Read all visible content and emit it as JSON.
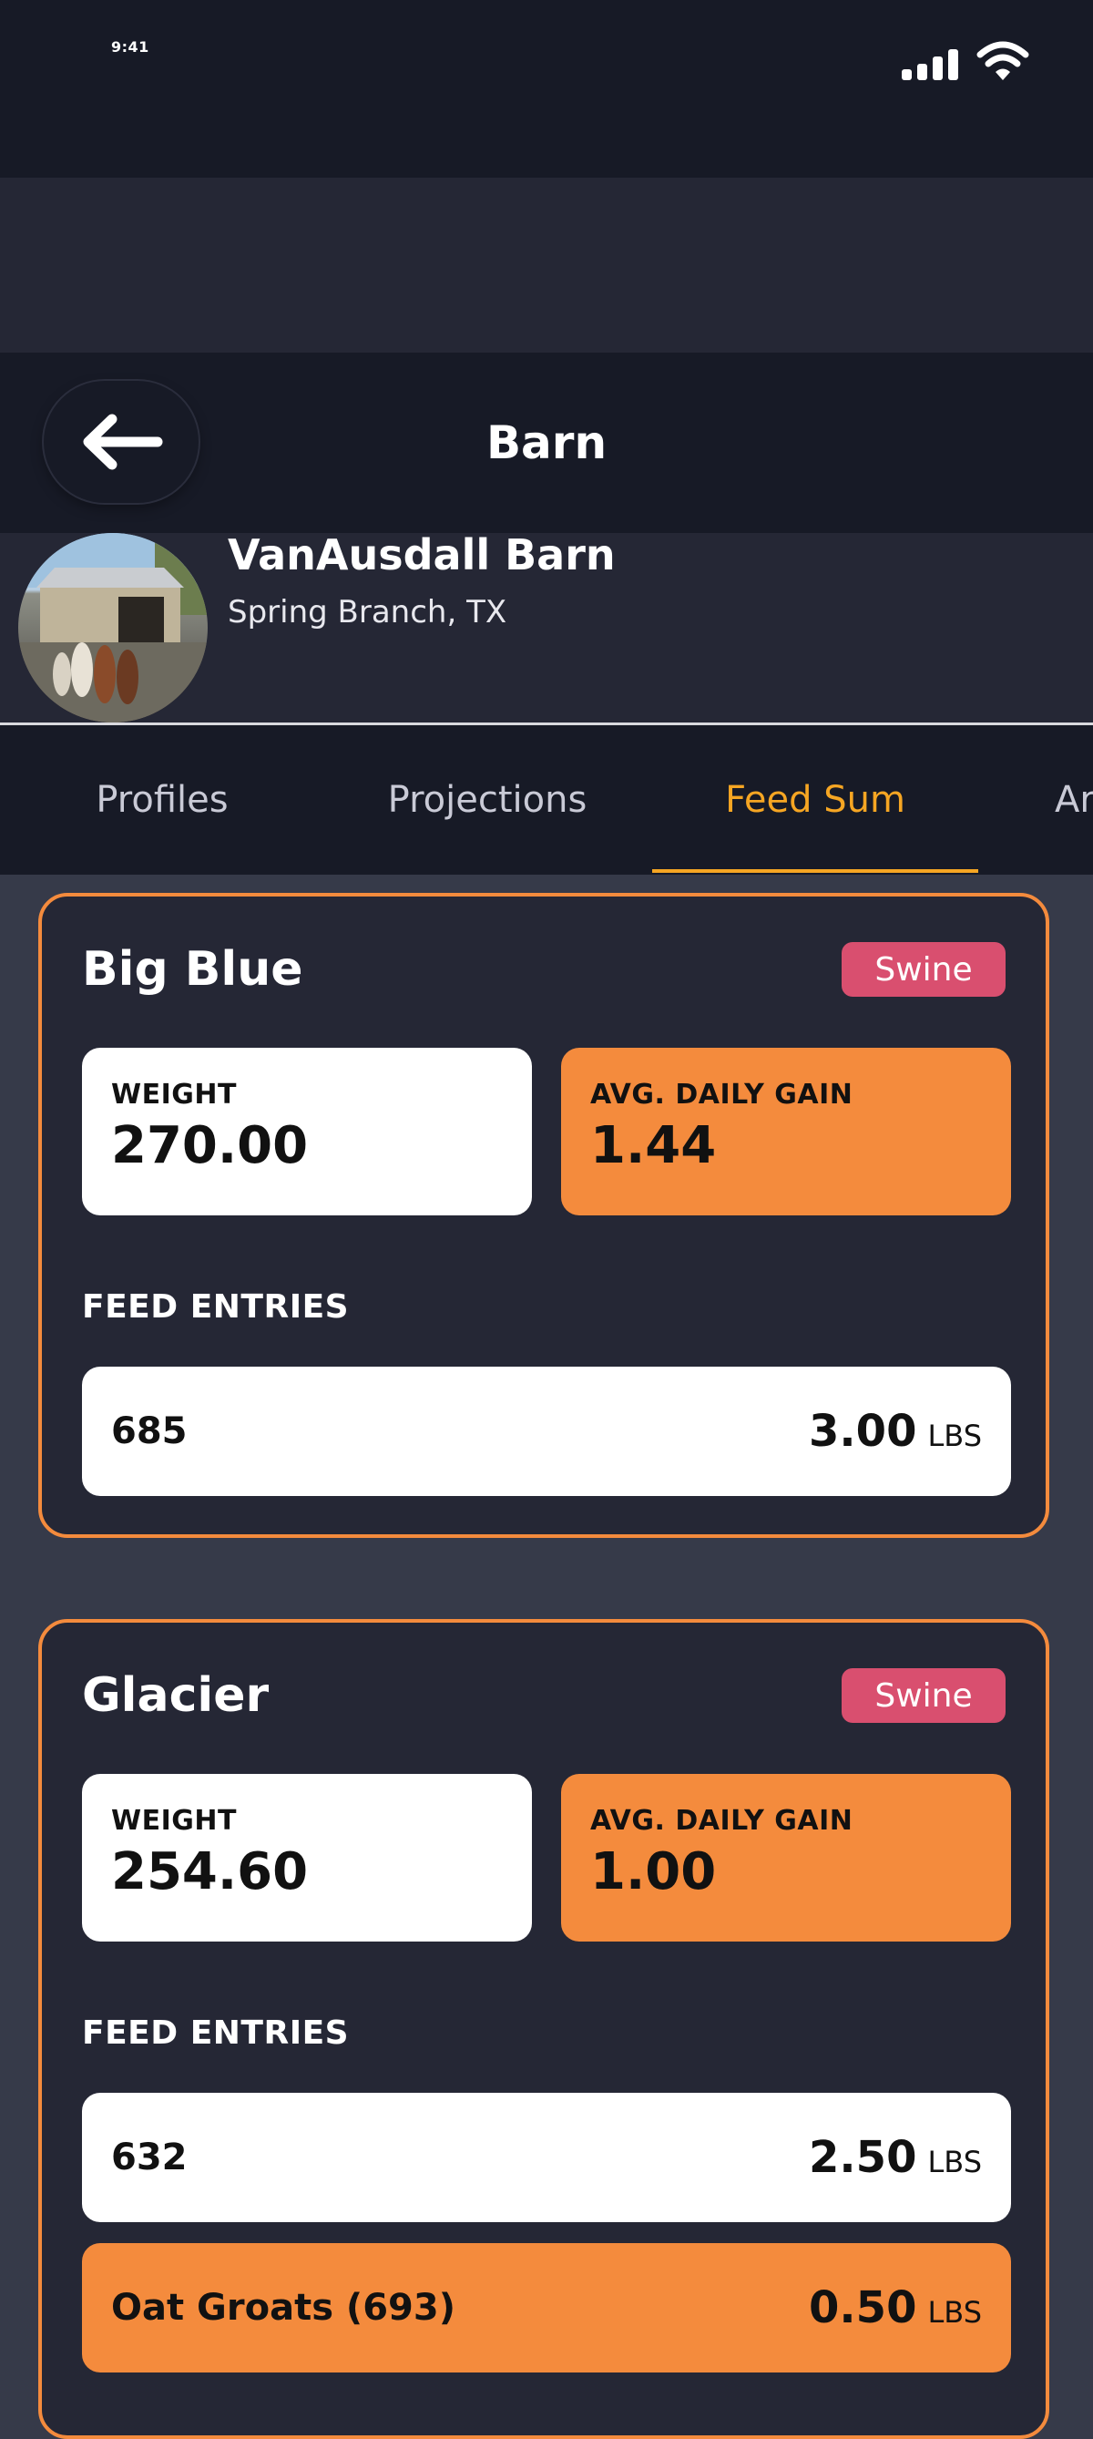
{
  "status_bar": {
    "time": "9:41"
  },
  "nav": {
    "title": "Barn"
  },
  "barn": {
    "name": "VanAusdall Barn",
    "location": "Spring Branch, TX"
  },
  "tabs": [
    {
      "label": "Profiles",
      "active": false
    },
    {
      "label": "Projections",
      "active": false
    },
    {
      "label": "Feed Sum",
      "active": true
    },
    {
      "label": "Ar",
      "active": false
    }
  ],
  "labels": {
    "weight": "WEIGHT",
    "avg_daily_gain": "AVG. DAILY GAIN",
    "feed_entries": "FEED ENTRIES"
  },
  "cards": [
    {
      "name": "Big Blue",
      "badge": "Swine",
      "weight": "270.00",
      "avg_daily_gain": "1.44",
      "feed_entries": [
        {
          "label": "685",
          "amount": "3.00",
          "unit": "LBS",
          "highlight": false
        }
      ]
    },
    {
      "name": "Glacier",
      "badge": "Swine",
      "weight": "254.60",
      "avg_daily_gain": "1.00",
      "feed_entries": [
        {
          "label": "632",
          "amount": "2.50",
          "unit": "LBS",
          "highlight": false
        },
        {
          "label": "Oat Groats (693)",
          "amount": "0.50",
          "unit": "LBS",
          "highlight": true
        }
      ]
    }
  ],
  "colors": {
    "accent": "#f6a623",
    "orange": "#f48b3d",
    "badge": "#d94f6f",
    "dark_bg": "#171a26",
    "card_bg": "#252735",
    "page_bg": "#363a49"
  }
}
